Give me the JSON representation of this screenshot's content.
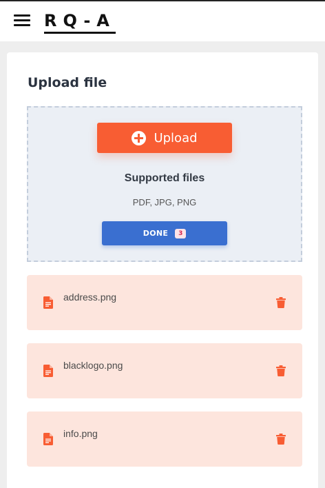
{
  "header": {
    "logo_text": "RQ-A",
    "menu_icon": "hamburger-menu-icon"
  },
  "upload_card": {
    "title": "Upload file",
    "upload_button_label": "Upload",
    "upload_icon": "plus-circle-icon",
    "supported_title": "Supported files",
    "supported_types": "PDF, JPG, PNG",
    "done_button_label": "DONE",
    "done_count": "3"
  },
  "files": [
    {
      "name": "address.png",
      "icon": "document-icon",
      "action_icon": "trash-icon"
    },
    {
      "name": "blacklogo.png",
      "icon": "document-icon",
      "action_icon": "trash-icon"
    },
    {
      "name": "info.png",
      "icon": "document-icon",
      "action_icon": "trash-icon"
    }
  ],
  "colors": {
    "accent": "#f85d33",
    "done_button": "#3a6fd0",
    "file_item_bg": "#fde5dd",
    "dropzone_bg": "#ebeff5"
  }
}
